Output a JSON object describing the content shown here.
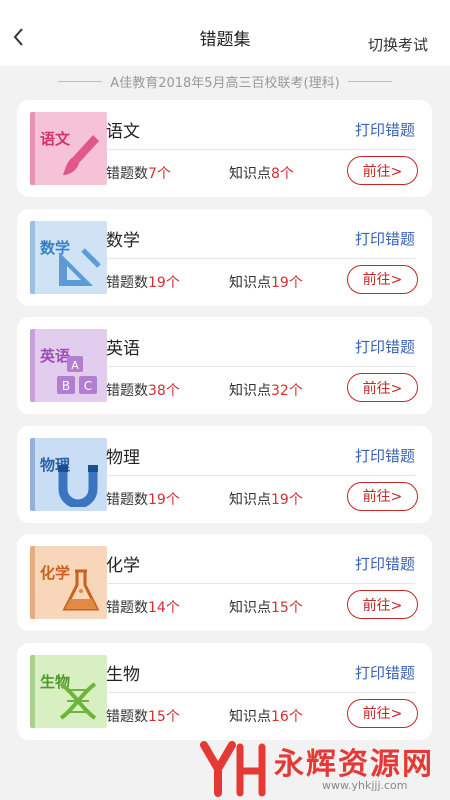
{
  "header": {
    "title": "错题集",
    "switch_label": "切换考试"
  },
  "exam_name": "A佳教育2018年5月高三百校联考(理科)",
  "labels": {
    "wrong_count": "错题数",
    "knowledge_points": "知识点",
    "print": "打印错题",
    "go": "前往>",
    "unit": "个"
  },
  "subjects": [
    {
      "name": "语文",
      "cover_tag": "语文",
      "wrong": "7",
      "points": "8",
      "color": "#f6c3d6",
      "tag_color": "#d3336c",
      "icon": "brush-icon"
    },
    {
      "name": "数学",
      "cover_tag": "数学",
      "wrong": "19",
      "points": "19",
      "color": "#cfe3f5",
      "tag_color": "#3a7fc4",
      "icon": "ruler-triangle-icon"
    },
    {
      "name": "英语",
      "cover_tag": "英语",
      "wrong": "38",
      "points": "32",
      "color": "#e3cdee",
      "tag_color": "#9a4fb4",
      "icon": "abc-blocks-icon"
    },
    {
      "name": "物理",
      "cover_tag": "物理",
      "wrong": "19",
      "points": "19",
      "color": "#c9def4",
      "tag_color": "#2e62a8",
      "icon": "magnet-icon"
    },
    {
      "name": "化学",
      "cover_tag": "化学",
      "wrong": "14",
      "points": "15",
      "color": "#f7d6b9",
      "tag_color": "#c9601c",
      "icon": "flask-icon"
    },
    {
      "name": "生物",
      "cover_tag": "生物",
      "wrong": "15",
      "points": "16",
      "color": "#d8efc1",
      "tag_color": "#4f9a2a",
      "icon": "dna-icon"
    }
  ],
  "watermark": {
    "text": "永辉资源网",
    "url": "www.yhkjjj.com"
  }
}
